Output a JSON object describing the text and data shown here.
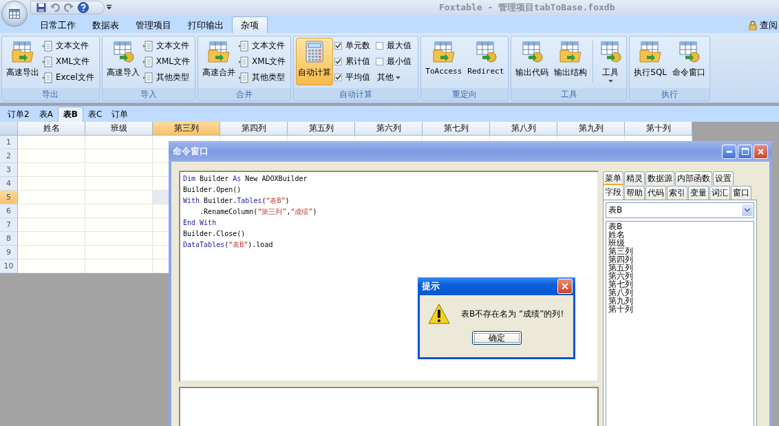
{
  "window": {
    "title": "Foxtable - 管理项目tabToBase.foxdb"
  },
  "ribbon_tabs": [
    {
      "label": "日常工作",
      "selected": false
    },
    {
      "label": "数据表",
      "selected": false
    },
    {
      "label": "管理项目",
      "selected": false
    },
    {
      "label": "打印输出",
      "selected": false
    },
    {
      "label": "杂项",
      "selected": true
    }
  ],
  "account": {
    "label": "查阅"
  },
  "ribbon_groups": [
    {
      "title": "导出",
      "items": [
        {
          "kind": "large",
          "label": "高速导出",
          "pressed": false
        },
        {
          "kind": "small",
          "label": "文本文件"
        },
        {
          "kind": "small",
          "label": "XML文件"
        },
        {
          "kind": "small",
          "label": "Excel文件"
        }
      ]
    },
    {
      "title": "导入",
      "items": [
        {
          "kind": "large",
          "label": "高速导入",
          "pressed": false
        },
        {
          "kind": "small",
          "label": "文本文件"
        },
        {
          "kind": "small",
          "label": "XML文件"
        },
        {
          "kind": "small",
          "label": "其他类型"
        }
      ]
    },
    {
      "title": "合并",
      "items": [
        {
          "kind": "large",
          "label": "高速合并",
          "pressed": false
        },
        {
          "kind": "small",
          "label": "文本文件"
        },
        {
          "kind": "small",
          "label": "XML文件"
        },
        {
          "kind": "small",
          "label": "其他类型"
        }
      ]
    },
    {
      "title": "自动计算",
      "items": [
        {
          "kind": "large",
          "label": "自动计算",
          "pressed": true
        },
        {
          "kind": "check",
          "label": "单元数",
          "checked": true
        },
        {
          "kind": "check",
          "label": "累计值",
          "checked": true
        },
        {
          "kind": "check",
          "label": "平均值",
          "checked": true
        },
        {
          "kind": "check",
          "label": "最大值",
          "checked": false
        },
        {
          "kind": "check",
          "label": "最小值",
          "checked": false
        },
        {
          "kind": "menu",
          "label": "其他"
        }
      ]
    },
    {
      "title": "重定向",
      "items": [
        {
          "kind": "large",
          "label": "ToAccess",
          "pressed": false
        },
        {
          "kind": "large",
          "label": "Redirect",
          "pressed": false
        }
      ]
    },
    {
      "title": "工具",
      "items": [
        {
          "kind": "large",
          "label": "输出代码",
          "pressed": false
        },
        {
          "kind": "large",
          "label": "输出结构",
          "pressed": false
        },
        {
          "kind": "large_menu",
          "label": "工具",
          "pressed": false
        }
      ]
    },
    {
      "title": "执行",
      "items": [
        {
          "kind": "large",
          "label": "执行SQL",
          "pressed": false
        },
        {
          "kind": "large",
          "label": "命令窗口",
          "pressed": false
        }
      ]
    }
  ],
  "sheet_tabs": [
    {
      "label": "订单2",
      "selected": false
    },
    {
      "label": "表A",
      "selected": false
    },
    {
      "label": "表B",
      "selected": true
    },
    {
      "label": "表C",
      "selected": false
    },
    {
      "label": "订单",
      "selected": false
    }
  ],
  "table": {
    "columns": [
      {
        "label": "姓名",
        "selected": false
      },
      {
        "label": "班级",
        "selected": false
      },
      {
        "label": "第三列",
        "selected": true
      },
      {
        "label": "第四列",
        "selected": false
      },
      {
        "label": "第五列",
        "selected": false
      },
      {
        "label": "第六列",
        "selected": false
      },
      {
        "label": "第七列",
        "selected": false
      },
      {
        "label": "第八列",
        "selected": false
      },
      {
        "label": "第九列",
        "selected": false
      },
      {
        "label": "第十列",
        "selected": false
      }
    ],
    "rows": [
      {
        "label": "1",
        "selected": false
      },
      {
        "label": "2",
        "selected": false
      },
      {
        "label": "3",
        "selected": false
      },
      {
        "label": "4",
        "selected": false
      },
      {
        "label": "5",
        "selected": true
      },
      {
        "label": "6",
        "selected": false
      },
      {
        "label": "7",
        "selected": false
      },
      {
        "label": "8",
        "selected": false
      },
      {
        "label": "9",
        "selected": false
      },
      {
        "label": "10",
        "selected": false
      }
    ]
  },
  "command_window": {
    "title": "命令窗口",
    "code": [
      [
        {
          "kind": "keyword",
          "text": "Dim"
        },
        {
          "kind": "plain",
          "text": " Builder "
        },
        {
          "kind": "keyword",
          "text": "As"
        },
        {
          "kind": "plain",
          "text": " New ADOXBuilder"
        }
      ],
      [
        {
          "kind": "plain",
          "text": "Builder.Open()"
        }
      ],
      [
        {
          "kind": "keyword",
          "text": "With"
        },
        {
          "kind": "plain",
          "text": " Builder."
        },
        {
          "kind": "keyword",
          "text": "Tables"
        },
        {
          "kind": "plain",
          "text": "("
        },
        {
          "kind": "string",
          "text": "“表B”"
        },
        {
          "kind": "plain",
          "text": ")"
        }
      ],
      [
        {
          "kind": "plain",
          "text": "    .RenameColumn("
        },
        {
          "kind": "string",
          "text": "“第三列”"
        },
        {
          "kind": "plain",
          "text": ","
        },
        {
          "kind": "string",
          "text": "“成绩”"
        },
        {
          "kind": "plain",
          "text": ")"
        }
      ],
      [
        {
          "kind": "keyword",
          "text": "End With"
        }
      ],
      [
        {
          "kind": "plain",
          "text": "Builder.Close()"
        }
      ],
      [
        {
          "kind": "keyword",
          "text": "DataTables"
        },
        {
          "kind": "plain",
          "text": "("
        },
        {
          "kind": "string",
          "text": "“表B”"
        },
        {
          "kind": "plain",
          "text": ").load"
        }
      ]
    ],
    "panel_tabs_back": [
      {
        "label": "菜单",
        "selected": false
      },
      {
        "label": "精灵",
        "selected": false
      },
      {
        "label": "数据源",
        "selected": false
      },
      {
        "label": "内部函数",
        "selected": false
      },
      {
        "label": "设置",
        "selected": false
      }
    ],
    "panel_tabs_front": [
      {
        "label": "字段",
        "selected": true
      },
      {
        "label": "帮助",
        "selected": false
      },
      {
        "label": "代码",
        "selected": false
      },
      {
        "label": "索引",
        "selected": false
      },
      {
        "label": "变量",
        "selected": false
      },
      {
        "label": "词汇",
        "selected": false
      },
      {
        "label": "窗口",
        "selected": false
      }
    ],
    "table_select": {
      "value": "表B"
    },
    "field_list": [
      "表B",
      "姓名",
      "班级",
      "第三列",
      "第四列",
      "第五列",
      "第六列",
      "第七列",
      "第八列",
      "第九列",
      "第十列"
    ]
  },
  "dialog": {
    "title": "提示",
    "message": "表B不存在名为 “成绩”的列!",
    "button": "确定"
  }
}
